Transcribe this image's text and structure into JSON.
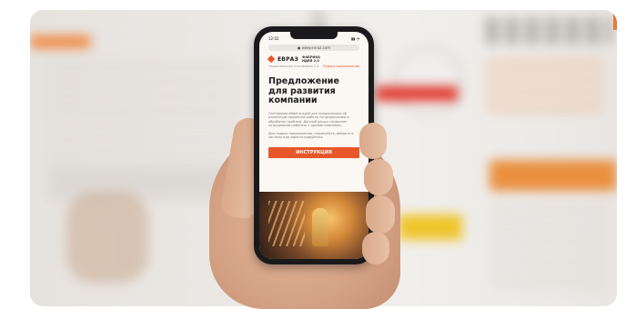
{
  "phone_screen": {
    "status_time": "12:02",
    "url": "● www.evraz.com",
    "logo_text": "ЕВРАЗ",
    "logo_sub_1": "ФАБРИКА",
    "logo_sub_2": "ИДЕЙ 2.0",
    "meta_left": "Национальная платформа 2.0",
    "meta_link": "Подача предложения",
    "headline": "Предложение для развития компании",
    "body_1": "Платформа обмена идей для предложения об изменении процессов работы по разрешению и обработке проблем. Данный ресурс позволяет сотрудникам работать с идеями компании.",
    "body_2": "Для подачи предложения, пожалуйста, войдите в систему или зарегистрируйтесь",
    "cta_label": "ИНСТРУКЦИЯ"
  },
  "colors": {
    "accent": "#e8572a",
    "red_bar": "#e0362b",
    "orange_block": "#e9903f",
    "yellow_block": "#efc52b"
  }
}
